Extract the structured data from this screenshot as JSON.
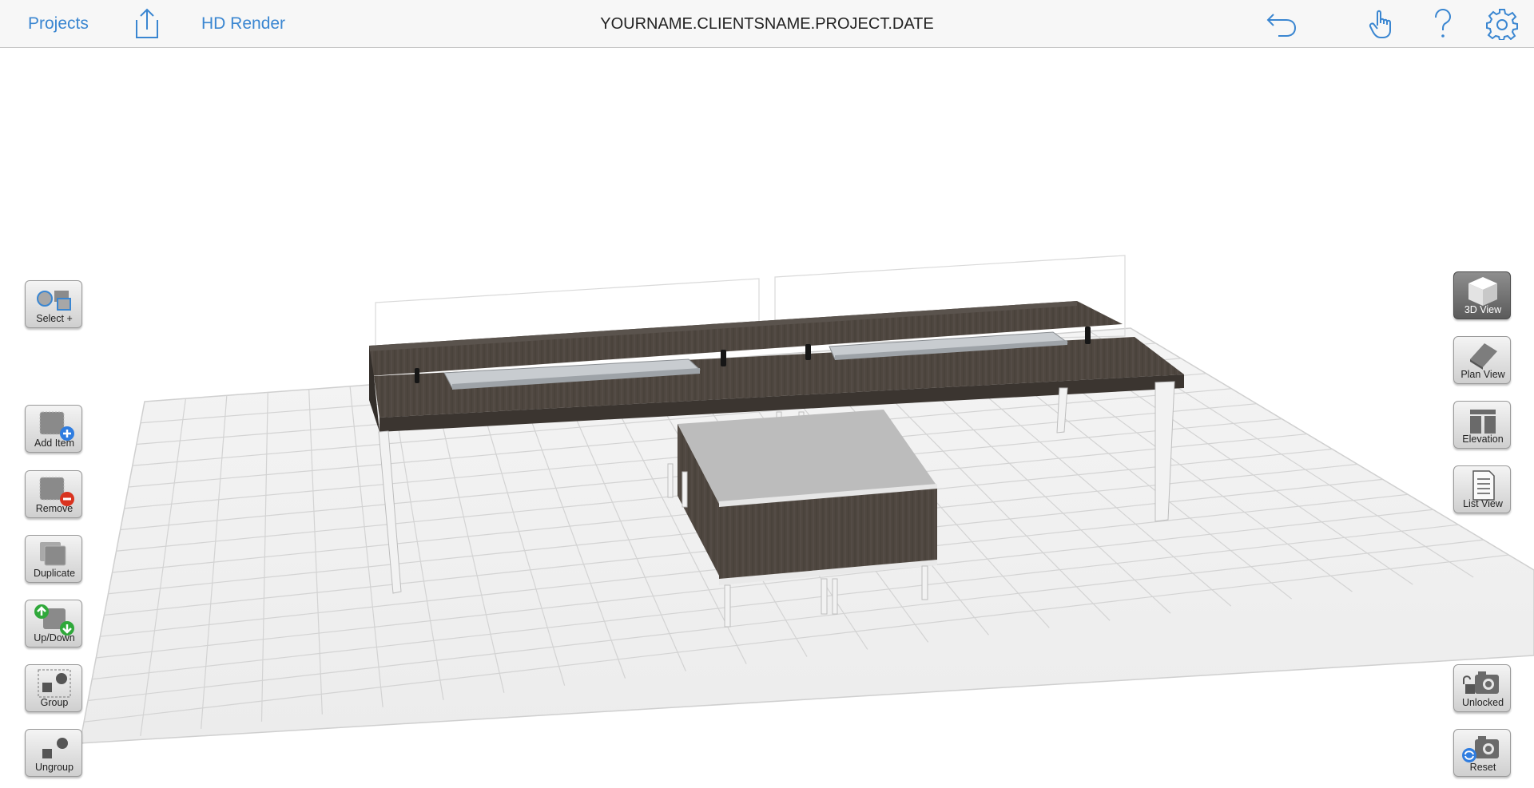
{
  "topbar": {
    "projects_label": "Projects",
    "hd_render_label": "HD Render",
    "document_title": "YOURNAME.CLIENTSNAME.PROJECT.DATE"
  },
  "left_toolbar": {
    "select": "Select +",
    "add_item": "Add Item",
    "remove": "Remove",
    "duplicate": "Duplicate",
    "up_down": "Up/Down",
    "group": "Group",
    "ungroup": "Ungroup"
  },
  "right_toolbar": {
    "view_3d": "3D View",
    "plan_view": "Plan View",
    "elevation": "Elevation",
    "list_view": "List View",
    "unlocked": "Unlocked",
    "reset": "Reset",
    "active_view": "3D View"
  },
  "colors": {
    "accent": "#3a86d1",
    "desk_top": "#4d4640",
    "desk_edge": "#3b3530",
    "active_button": "#6a6a6a"
  }
}
